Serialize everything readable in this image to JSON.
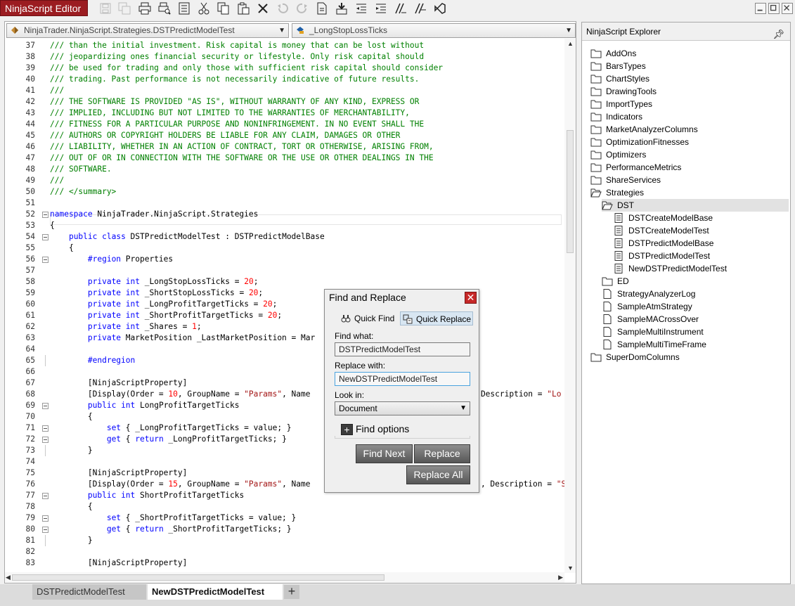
{
  "app": {
    "title": "NinjaScript Editor"
  },
  "toolbar": {
    "icons": [
      "save-icon",
      "save-all-icon",
      "print-icon",
      "print-preview-icon",
      "properties-icon",
      "cut-icon",
      "copy-icon",
      "paste-icon",
      "delete-icon",
      "undo-icon",
      "redo-icon",
      "compile-icon",
      "insert-snippet-icon",
      "outdent-icon",
      "indent-icon",
      "comment-icon",
      "uncomment-icon",
      "visual-studio-icon"
    ]
  },
  "editor": {
    "class_selector": "NinjaTrader.NinjaScript.Strategies.DSTPredictModelTest",
    "member_selector": "_LongStopLossTicks",
    "lines": [
      {
        "n": "37",
        "fold": "",
        "segs": [
          {
            "t": "/// than the initial investment. Risk capital is money that can be lost without",
            "c": "cm"
          }
        ]
      },
      {
        "n": "38",
        "fold": "",
        "segs": [
          {
            "t": "/// jeopardizing ones financial security or lifestyle. Only risk capital should",
            "c": "cm"
          }
        ]
      },
      {
        "n": "39",
        "fold": "",
        "segs": [
          {
            "t": "/// be used for trading and only those with sufficient risk capital should consider",
            "c": "cm"
          }
        ]
      },
      {
        "n": "40",
        "fold": "",
        "segs": [
          {
            "t": "/// trading. Past performance is not necessarily indicative of future results.",
            "c": "cm"
          }
        ]
      },
      {
        "n": "41",
        "fold": "",
        "segs": [
          {
            "t": "///",
            "c": "cm"
          }
        ]
      },
      {
        "n": "42",
        "fold": "",
        "segs": [
          {
            "t": "/// THE SOFTWARE IS PROVIDED \"AS IS\", WITHOUT WARRANTY OF ANY KIND, EXPRESS OR",
            "c": "cm"
          }
        ]
      },
      {
        "n": "43",
        "fold": "",
        "segs": [
          {
            "t": "/// IMPLIED, INCLUDING BUT NOT LIMITED TO THE WARRANTIES OF MERCHANTABILITY,",
            "c": "cm"
          }
        ]
      },
      {
        "n": "44",
        "fold": "",
        "segs": [
          {
            "t": "/// FITNESS FOR A PARTICULAR PURPOSE AND NONINFRINGEMENT. IN NO EVENT SHALL THE",
            "c": "cm"
          }
        ]
      },
      {
        "n": "45",
        "fold": "",
        "segs": [
          {
            "t": "/// AUTHORS OR COPYRIGHT HOLDERS BE LIABLE FOR ANY CLAIM, DAMAGES OR OTHER",
            "c": "cm"
          }
        ]
      },
      {
        "n": "46",
        "fold": "",
        "segs": [
          {
            "t": "/// LIABILITY, WHETHER IN AN ACTION OF CONTRACT, TORT OR OTHERWISE, ARISING FROM,",
            "c": "cm"
          }
        ]
      },
      {
        "n": "47",
        "fold": "",
        "segs": [
          {
            "t": "/// OUT OF OR IN CONNECTION WITH THE SOFTWARE OR THE USE OR OTHER DEALINGS IN THE",
            "c": "cm"
          }
        ]
      },
      {
        "n": "48",
        "fold": "",
        "segs": [
          {
            "t": "/// SOFTWARE.",
            "c": "cm"
          }
        ]
      },
      {
        "n": "49",
        "fold": "",
        "segs": [
          {
            "t": "///",
            "c": "cm"
          }
        ]
      },
      {
        "n": "50",
        "fold": "",
        "segs": [
          {
            "t": "/// </summary>",
            "c": "cm"
          }
        ]
      },
      {
        "n": "51",
        "fold": "",
        "segs": []
      },
      {
        "n": "52",
        "fold": "box",
        "segs": [
          {
            "t": "namespace",
            "c": "kw"
          },
          {
            "t": " NinjaTrader.NinjaScript.Strategies",
            "c": ""
          }
        ]
      },
      {
        "n": "53",
        "fold": "",
        "segs": [
          {
            "t": "{",
            "c": ""
          }
        ]
      },
      {
        "n": "54",
        "fold": "box",
        "segs": [
          {
            "t": "    ",
            "c": ""
          },
          {
            "t": "public",
            "c": "kw"
          },
          {
            "t": " ",
            "c": ""
          },
          {
            "t": "class",
            "c": "kw"
          },
          {
            "t": " DSTPredictModelTest : DSTPredictModelBase",
            "c": ""
          }
        ]
      },
      {
        "n": "55",
        "fold": "",
        "segs": [
          {
            "t": "    {",
            "c": ""
          }
        ]
      },
      {
        "n": "56",
        "fold": "box",
        "segs": [
          {
            "t": "        ",
            "c": ""
          },
          {
            "t": "#region",
            "c": "kw"
          },
          {
            "t": " Properties",
            "c": ""
          }
        ]
      },
      {
        "n": "57",
        "fold": "",
        "segs": []
      },
      {
        "n": "58",
        "fold": "",
        "segs": [
          {
            "t": "        ",
            "c": ""
          },
          {
            "t": "private",
            "c": "kw"
          },
          {
            "t": " ",
            "c": ""
          },
          {
            "t": "int",
            "c": "kw"
          },
          {
            "t": " _LongStopLossTicks = ",
            "c": ""
          },
          {
            "t": "20",
            "c": "num"
          },
          {
            "t": ";",
            "c": ""
          }
        ]
      },
      {
        "n": "59",
        "fold": "",
        "segs": [
          {
            "t": "        ",
            "c": ""
          },
          {
            "t": "private",
            "c": "kw"
          },
          {
            "t": " ",
            "c": ""
          },
          {
            "t": "int",
            "c": "kw"
          },
          {
            "t": " _ShortStopLossTicks = ",
            "c": ""
          },
          {
            "t": "20",
            "c": "num"
          },
          {
            "t": ";",
            "c": ""
          }
        ]
      },
      {
        "n": "60",
        "fold": "",
        "segs": [
          {
            "t": "        ",
            "c": ""
          },
          {
            "t": "private",
            "c": "kw"
          },
          {
            "t": " ",
            "c": ""
          },
          {
            "t": "int",
            "c": "kw"
          },
          {
            "t": " _LongProfitTargetTicks = ",
            "c": ""
          },
          {
            "t": "20",
            "c": "num"
          },
          {
            "t": ";",
            "c": ""
          }
        ]
      },
      {
        "n": "61",
        "fold": "",
        "segs": [
          {
            "t": "        ",
            "c": ""
          },
          {
            "t": "private",
            "c": "kw"
          },
          {
            "t": " ",
            "c": ""
          },
          {
            "t": "int",
            "c": "kw"
          },
          {
            "t": " _ShortProfitTargetTicks = ",
            "c": ""
          },
          {
            "t": "20",
            "c": "num"
          },
          {
            "t": ";",
            "c": ""
          }
        ]
      },
      {
        "n": "62",
        "fold": "",
        "segs": [
          {
            "t": "        ",
            "c": ""
          },
          {
            "t": "private",
            "c": "kw"
          },
          {
            "t": " ",
            "c": ""
          },
          {
            "t": "int",
            "c": "kw"
          },
          {
            "t": " _Shares = ",
            "c": ""
          },
          {
            "t": "1",
            "c": "num"
          },
          {
            "t": ";",
            "c": ""
          }
        ]
      },
      {
        "n": "63",
        "fold": "",
        "segs": [
          {
            "t": "        ",
            "c": ""
          },
          {
            "t": "private",
            "c": "kw"
          },
          {
            "t": " MarketPosition _LastMarketPosition = Mar",
            "c": ""
          }
        ]
      },
      {
        "n": "64",
        "fold": "",
        "segs": []
      },
      {
        "n": "65",
        "fold": "tick",
        "segs": [
          {
            "t": "        ",
            "c": ""
          },
          {
            "t": "#endregion",
            "c": "kw"
          }
        ]
      },
      {
        "n": "66",
        "fold": "",
        "segs": []
      },
      {
        "n": "67",
        "fold": "",
        "segs": [
          {
            "t": "        [NinjaScriptProperty]",
            "c": ""
          }
        ]
      },
      {
        "n": "68",
        "fold": "",
        "segs": [
          {
            "t": "        [Display(Order = ",
            "c": ""
          },
          {
            "t": "10",
            "c": "num"
          },
          {
            "t": ", GroupName = ",
            "c": ""
          },
          {
            "t": "\"Params\"",
            "c": "str"
          },
          {
            "t": ", Name                                    Description = ",
            "c": ""
          },
          {
            "t": "\"Lo",
            "c": "str"
          }
        ]
      },
      {
        "n": "69",
        "fold": "box",
        "segs": [
          {
            "t": "        ",
            "c": ""
          },
          {
            "t": "public",
            "c": "kw"
          },
          {
            "t": " ",
            "c": ""
          },
          {
            "t": "int",
            "c": "kw"
          },
          {
            "t": " LongProfitTargetTicks",
            "c": ""
          }
        ]
      },
      {
        "n": "70",
        "fold": "",
        "segs": [
          {
            "t": "        {",
            "c": ""
          }
        ]
      },
      {
        "n": "71",
        "fold": "box",
        "segs": [
          {
            "t": "            ",
            "c": ""
          },
          {
            "t": "set",
            "c": "kw"
          },
          {
            "t": " { _LongProfitTargetTicks = value; }",
            "c": ""
          }
        ]
      },
      {
        "n": "72",
        "fold": "box",
        "segs": [
          {
            "t": "            ",
            "c": ""
          },
          {
            "t": "get",
            "c": "kw"
          },
          {
            "t": " { ",
            "c": ""
          },
          {
            "t": "return",
            "c": "kw"
          },
          {
            "t": " _LongProfitTargetTicks; }",
            "c": ""
          }
        ]
      },
      {
        "n": "73",
        "fold": "tick",
        "segs": [
          {
            "t": "        }",
            "c": ""
          }
        ]
      },
      {
        "n": "74",
        "fold": "",
        "segs": []
      },
      {
        "n": "75",
        "fold": "",
        "segs": [
          {
            "t": "        [NinjaScriptProperty]",
            "c": ""
          }
        ]
      },
      {
        "n": "76",
        "fold": "",
        "segs": [
          {
            "t": "        [Display(Order = ",
            "c": ""
          },
          {
            "t": "15",
            "c": "num"
          },
          {
            "t": ", GroupName = ",
            "c": ""
          },
          {
            "t": "\"Params\"",
            "c": "str"
          },
          {
            "t": ", Name                                    , Description = ",
            "c": ""
          },
          {
            "t": "\"S",
            "c": "str"
          }
        ]
      },
      {
        "n": "77",
        "fold": "box",
        "segs": [
          {
            "t": "        ",
            "c": ""
          },
          {
            "t": "public",
            "c": "kw"
          },
          {
            "t": " ",
            "c": ""
          },
          {
            "t": "int",
            "c": "kw"
          },
          {
            "t": " ShortProfitTargetTicks",
            "c": ""
          }
        ]
      },
      {
        "n": "78",
        "fold": "",
        "segs": [
          {
            "t": "        {",
            "c": ""
          }
        ]
      },
      {
        "n": "79",
        "fold": "box",
        "segs": [
          {
            "t": "            ",
            "c": ""
          },
          {
            "t": "set",
            "c": "kw"
          },
          {
            "t": " { _ShortProfitTargetTicks = value; }",
            "c": ""
          }
        ]
      },
      {
        "n": "80",
        "fold": "box",
        "segs": [
          {
            "t": "            ",
            "c": ""
          },
          {
            "t": "get",
            "c": "kw"
          },
          {
            "t": " { ",
            "c": ""
          },
          {
            "t": "return",
            "c": "kw"
          },
          {
            "t": " _ShortProfitTargetTicks; }",
            "c": ""
          }
        ]
      },
      {
        "n": "81",
        "fold": "tick",
        "segs": [
          {
            "t": "        }",
            "c": ""
          }
        ]
      },
      {
        "n": "82",
        "fold": "",
        "segs": []
      },
      {
        "n": "83",
        "fold": "",
        "segs": [
          {
            "t": "        [NinjaScriptProperty]",
            "c": ""
          }
        ]
      }
    ]
  },
  "doc_tabs": {
    "inactive": "DSTPredictModelTest",
    "active": "NewDSTPredictModelTest",
    "add": "+"
  },
  "explorer": {
    "title": "NinjaScript Explorer",
    "items": [
      {
        "label": "AddOns",
        "depth": 0,
        "icon": "folder"
      },
      {
        "label": "BarsTypes",
        "depth": 0,
        "icon": "folder"
      },
      {
        "label": "ChartStyles",
        "depth": 0,
        "icon": "folder"
      },
      {
        "label": "DrawingTools",
        "depth": 0,
        "icon": "folder"
      },
      {
        "label": "ImportTypes",
        "depth": 0,
        "icon": "folder"
      },
      {
        "label": "Indicators",
        "depth": 0,
        "icon": "folder"
      },
      {
        "label": "MarketAnalyzerColumns",
        "depth": 0,
        "icon": "folder"
      },
      {
        "label": "OptimizationFitnesses",
        "depth": 0,
        "icon": "folder"
      },
      {
        "label": "Optimizers",
        "depth": 0,
        "icon": "folder"
      },
      {
        "label": "PerformanceMetrics",
        "depth": 0,
        "icon": "folder"
      },
      {
        "label": "ShareServices",
        "depth": 0,
        "icon": "folder"
      },
      {
        "label": "Strategies",
        "depth": 0,
        "icon": "folder-open"
      },
      {
        "label": "DST",
        "depth": 1,
        "icon": "folder-open",
        "selected": true
      },
      {
        "label": "DSTCreateModelBase",
        "depth": 2,
        "icon": "file"
      },
      {
        "label": "DSTCreateModelTest",
        "depth": 2,
        "icon": "file"
      },
      {
        "label": "DSTPredictModelBase",
        "depth": 2,
        "icon": "file"
      },
      {
        "label": "DSTPredictModelTest",
        "depth": 2,
        "icon": "file"
      },
      {
        "label": "NewDSTPredictModelTest",
        "depth": 2,
        "icon": "file"
      },
      {
        "label": "ED",
        "depth": 1,
        "icon": "folder"
      },
      {
        "label": "StrategyAnalyzerLog",
        "depth": 1,
        "icon": "file-blank"
      },
      {
        "label": "SampleAtmStrategy",
        "depth": 1,
        "icon": "file-blank"
      },
      {
        "label": "SampleMACrossOver",
        "depth": 1,
        "icon": "file-blank"
      },
      {
        "label": "SampleMultiInstrument",
        "depth": 1,
        "icon": "file-blank"
      },
      {
        "label": "SampleMultiTimeFrame",
        "depth": 1,
        "icon": "file-blank"
      },
      {
        "label": "SuperDomColumns",
        "depth": 0,
        "icon": "folder"
      }
    ]
  },
  "dialog": {
    "title": "Find and Replace",
    "tab_find": "Quick Find",
    "tab_replace": "Quick Replace",
    "find_label": "Find what:",
    "find_value": "DSTPredictModelTest",
    "replace_label": "Replace with:",
    "replace_value": "NewDSTPredictModelTest",
    "lookin_label": "Look in:",
    "lookin_value": "Document",
    "find_options": "Find options",
    "btn_find_next": "Find Next",
    "btn_replace": "Replace",
    "btn_replace_all": "Replace All"
  }
}
